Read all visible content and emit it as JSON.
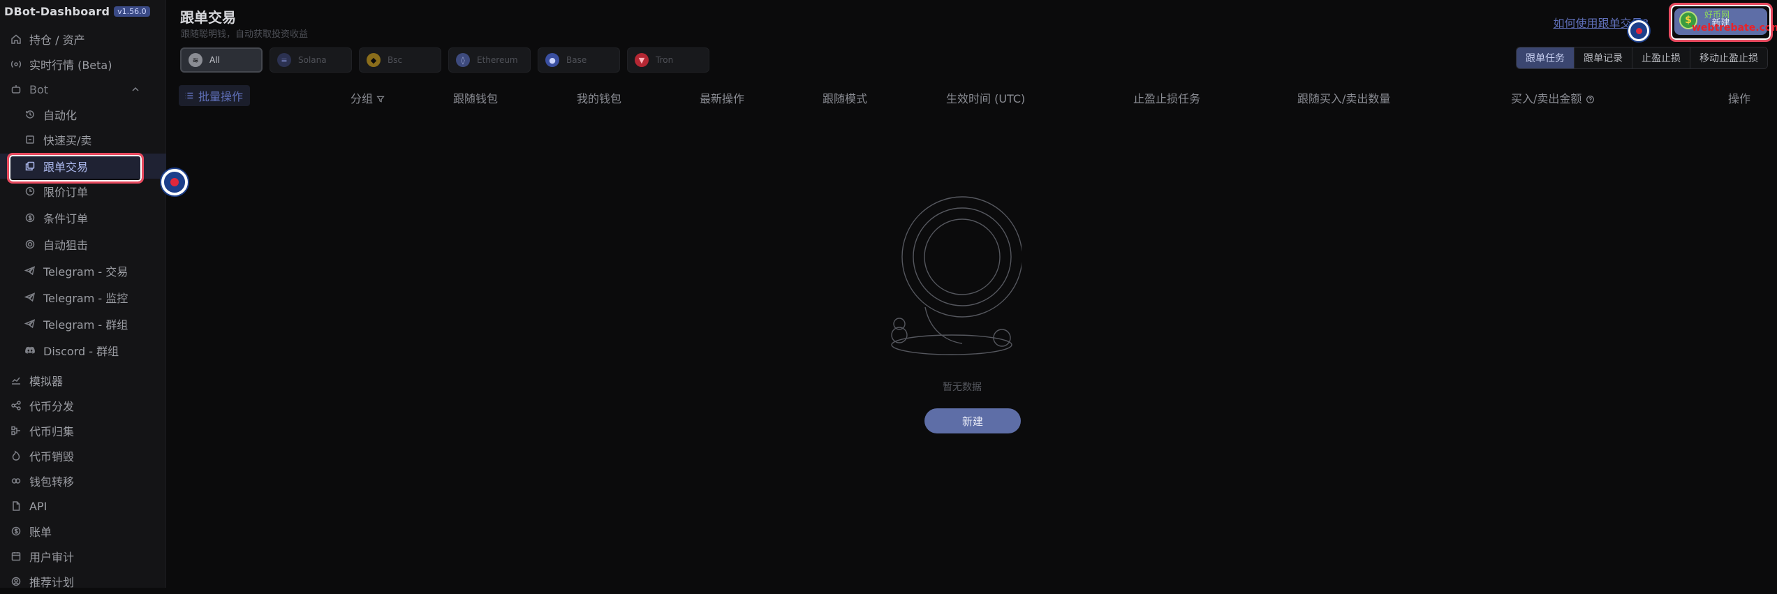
{
  "app": {
    "name": "DBot-Dashboard",
    "version": "v1.56.0"
  },
  "sidebar": {
    "items": [
      {
        "label": "持仓 / 资产",
        "icon": "home-icon"
      },
      {
        "label": "实时行情 (Beta)",
        "icon": "broadcast-icon"
      },
      {
        "label": "Bot",
        "icon": "bot-icon"
      },
      {
        "label": "自动化",
        "icon": "history-icon"
      },
      {
        "label": "快速买/卖",
        "icon": "square-icon"
      },
      {
        "label": "跟单交易",
        "icon": "copy-icon"
      },
      {
        "label": "限价订单",
        "icon": "clock-icon"
      },
      {
        "label": "条件订单",
        "icon": "dollar-icon"
      },
      {
        "label": "自动狙击",
        "icon": "target-icon"
      },
      {
        "label": "Telegram - 交易",
        "icon": "telegram-icon"
      },
      {
        "label": "Telegram - 监控",
        "icon": "telegram-icon"
      },
      {
        "label": "Telegram - 群组",
        "icon": "telegram-icon"
      },
      {
        "label": "Discord - 群组",
        "icon": "discord-icon"
      },
      {
        "label": "模拟器",
        "icon": "chart-line-icon"
      },
      {
        "label": "代币分发",
        "icon": "share-icon"
      },
      {
        "label": "代币归集",
        "icon": "merge-icon"
      },
      {
        "label": "代币销毁",
        "icon": "flame-icon"
      },
      {
        "label": "钱包转移",
        "icon": "wallet-icon"
      },
      {
        "label": "API",
        "icon": "file-icon"
      },
      {
        "label": "账单",
        "icon": "dollar-circle-icon"
      },
      {
        "label": "用户审计",
        "icon": "calendar-icon"
      },
      {
        "label": "推荐计划",
        "icon": "user-icon"
      }
    ]
  },
  "header": {
    "title": "跟单交易",
    "subtitle": "跟随聪明钱，自动获取投资收益",
    "help_link": "如何使用跟单交易?",
    "new_button": "新建"
  },
  "watermark": {
    "top": "好币网",
    "bottom": "webtrebate.com"
  },
  "chains": [
    {
      "label": "All",
      "color": "#8b8d94",
      "glyph": "≋"
    },
    {
      "label": "Solana",
      "color": "#2b3150",
      "glyph": "≡"
    },
    {
      "label": "Bsc",
      "color": "#8a6d1b",
      "glyph": "◆"
    },
    {
      "label": "Ethereum",
      "color": "#3d4a7d",
      "glyph": "◊"
    },
    {
      "label": "Base",
      "color": "#3a4fa0",
      "glyph": "●"
    },
    {
      "label": "Tron",
      "color": "#b42733",
      "glyph": "▼"
    }
  ],
  "tabs": [
    {
      "label": "跟单任务"
    },
    {
      "label": "跟单记录"
    },
    {
      "label": "止盈止损"
    },
    {
      "label": "移动止盈止损"
    }
  ],
  "table": {
    "batch_label": "批量操作",
    "columns": [
      {
        "label": "分组"
      },
      {
        "label": "跟随钱包"
      },
      {
        "label": "我的钱包"
      },
      {
        "label": "最新操作"
      },
      {
        "label": "跟随模式"
      },
      {
        "label": "生效时间 (UTC)"
      },
      {
        "label": "止盈止损任务"
      },
      {
        "label": "跟随买入/卖出数量"
      },
      {
        "label": "买入/卖出金额"
      },
      {
        "label": "操作"
      }
    ]
  },
  "empty": {
    "text": "暂无数据",
    "button": "新建"
  }
}
